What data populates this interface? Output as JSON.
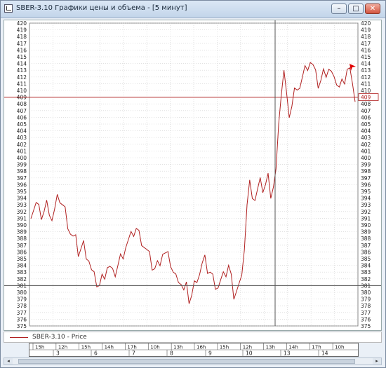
{
  "window": {
    "title": "SBER-3.10 Графики цены и объема - [5 минут]",
    "minimize_label": "–",
    "maximize_label": "□",
    "close_label": "✕"
  },
  "legend": {
    "series_name": "SBER-3.10 - Price",
    "color": "#b02020"
  },
  "colors": {
    "price": "#b02020",
    "current_line": "#b02020",
    "crosshair": "#555555",
    "grid": "#d0d0d0"
  },
  "crosshair": {
    "price": 381
  },
  "chart_data": {
    "type": "line",
    "title": "",
    "ylim": [
      375,
      420
    ],
    "y_ticks": [
      "420",
      "419",
      "418",
      "417",
      "416",
      "415",
      "414",
      "413",
      "412",
      "411",
      "410",
      "409",
      "408",
      "407",
      "406",
      "405",
      "404",
      "403",
      "402",
      "401",
      "400",
      "399",
      "398",
      "397",
      "396",
      "395",
      "394",
      "393",
      "392",
      "391",
      "390",
      "389",
      "388",
      "387",
      "386",
      "385",
      "384",
      "383",
      "382",
      "381",
      "380",
      "379",
      "378",
      "377",
      "376",
      "375"
    ],
    "current_price": 409,
    "current_price_label": "409",
    "time_labels_top": [
      "15h",
      "12h",
      "15h",
      "14h",
      "17h",
      "10h",
      "13h",
      "16h",
      "15h",
      "12h",
      "13h",
      "14h",
      "17h",
      "10h"
    ],
    "date_labels": [
      "3",
      "6",
      "7",
      "8",
      "9",
      "10",
      "13",
      "14"
    ],
    "series": [
      {
        "name": "SBER-3.10 - Price",
        "values": [
          392,
          392.5,
          393,
          392,
          391.5,
          392,
          393,
          392.5,
          391,
          392,
          393.5,
          394,
          393,
          392,
          390.5,
          389,
          388,
          387.5,
          386,
          386.5,
          387,
          386,
          385,
          383,
          382,
          381.5,
          381,
          382,
          383,
          384,
          383.5,
          382.5,
          383,
          384,
          385,
          386,
          387,
          387.5,
          388,
          389,
          389.5,
          388.5,
          388,
          387,
          386,
          385,
          384,
          383.5,
          384,
          385,
          386,
          385.5,
          385,
          384.5,
          383,
          382,
          382.5,
          381.5,
          380,
          380.5,
          379,
          379.5,
          381,
          382.5,
          383,
          384,
          384.5,
          383.5,
          383,
          382,
          381.5,
          381,
          381.5,
          382,
          383,
          384,
          382,
          380,
          380.5,
          381,
          381.5,
          387,
          393,
          396,
          395,
          394,
          395,
          396,
          395.5,
          396,
          397,
          395,
          396,
          398,
          404,
          410,
          413,
          409,
          407,
          408,
          410,
          409,
          411,
          412,
          413,
          414,
          414.5,
          413.5,
          412,
          411,
          411.5,
          412.5,
          413,
          413.5,
          412.5,
          411,
          411.5,
          410.5,
          411,
          412,
          413.5,
          413,
          410,
          409
        ]
      }
    ]
  }
}
